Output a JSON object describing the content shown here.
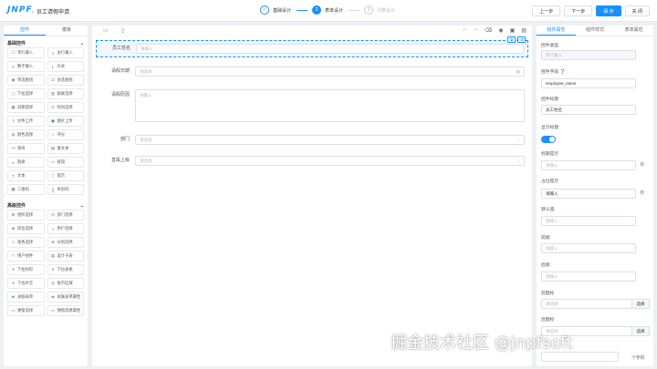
{
  "app": {
    "logo": "JNPF",
    "back": "‹",
    "title": "员工请假申请"
  },
  "steps": [
    {
      "num": "✓",
      "label": "基础设计"
    },
    {
      "num": "2",
      "label": "表单设计"
    },
    {
      "num": "3",
      "label": "列表设计"
    }
  ],
  "top_buttons": {
    "prev": "上一步",
    "next": "下一步",
    "save": "保 存",
    "close": "关 闭"
  },
  "left_panel": {
    "tabs": [
      "控件",
      "模板"
    ],
    "basic_title": "基础控件",
    "basic_items": [
      {
        "icon": "☐",
        "label": "单行输入"
      },
      {
        "icon": "≡",
        "label": "多行输入"
      },
      {
        "icon": "#",
        "label": "数字输入"
      },
      {
        "icon": "◐",
        "label": "开关"
      },
      {
        "icon": "◉",
        "label": "单选框组"
      },
      {
        "icon": "☑",
        "label": "多选框组"
      },
      {
        "icon": "▢",
        "label": "下拉选择"
      },
      {
        "icon": "▥",
        "label": "级联选择"
      },
      {
        "icon": "▦",
        "label": "日期选择"
      },
      {
        "icon": "◷",
        "label": "时间选择"
      },
      {
        "icon": "⇪",
        "label": "文件上传"
      },
      {
        "icon": "▣",
        "label": "图片上传"
      },
      {
        "icon": "◍",
        "label": "颜色选择"
      },
      {
        "icon": "☆",
        "label": "评分"
      },
      {
        "icon": "⊶",
        "label": "滑块"
      },
      {
        "icon": "▤",
        "label": "富文本"
      },
      {
        "icon": "∞",
        "label": "链接"
      },
      {
        "icon": "▭",
        "label": "按钮"
      },
      {
        "icon": "T",
        "label": "文本"
      },
      {
        "icon": "ⓘ",
        "label": "提示"
      },
      {
        "icon": "▩",
        "label": "二维码"
      },
      {
        "icon": "║",
        "label": "条形码"
      }
    ],
    "advanced_title": "高级控件",
    "advanced_items": [
      {
        "icon": "⊞",
        "label": "组织选择"
      },
      {
        "icon": "⊡",
        "label": "部门选择"
      },
      {
        "icon": "◈",
        "label": "岗位选择"
      },
      {
        "icon": "☺",
        "label": "用户选择"
      },
      {
        "icon": "◇",
        "label": "角色选择"
      },
      {
        "icon": "⊕",
        "label": "分组选择"
      },
      {
        "icon": "⚇",
        "label": "用户组件"
      },
      {
        "icon": "▤",
        "label": "设计子表"
      },
      {
        "icon": "▾",
        "label": "下拉树形"
      },
      {
        "icon": "▾",
        "label": "下拉表格"
      },
      {
        "icon": "▾",
        "label": "下拉补全"
      },
      {
        "icon": "◎",
        "label": "省市区域"
      },
      {
        "icon": "⇄",
        "label": "关联表单"
      },
      {
        "icon": "⇄",
        "label": "关联表单属性"
      },
      {
        "icon": "▭",
        "label": "弹窗选择"
      },
      {
        "icon": "▭",
        "label": "弹窗选择属性"
      }
    ]
  },
  "canvas": {
    "fields": [
      {
        "label": "员工姓名",
        "placeholder": "请输入",
        "trail": ""
      },
      {
        "label": "请假日期",
        "placeholder": "请选择",
        "trail": "▦"
      },
      {
        "label": "请假原因",
        "placeholder": "请输入",
        "trail": ""
      },
      {
        "label": "部门",
        "placeholder": "请选择",
        "trail": "⌄"
      },
      {
        "label": "直属上级",
        "placeholder": "请选择",
        "trail": "⌄"
      }
    ]
  },
  "right_panel": {
    "tabs": [
      "组件属性",
      "组件样式",
      "表单属性"
    ],
    "control_type_label": "控件类型",
    "control_type_value": "单行输入",
    "field_label": "控件字段",
    "field_value": "employee_name",
    "title_label": "控件标题",
    "title_value": "员工姓名",
    "show_title_label": "显示标题",
    "title_hint_label": "标题提示",
    "title_hint_placeholder": "请输入",
    "placeholder_label": "占位提示",
    "placeholder_value": "请输入",
    "default_label": "默认值",
    "default_placeholder": "请输入",
    "prefix_label": "前缀",
    "prefix_placeholder": "请输入",
    "suffix_label": "后缀",
    "suffix_placeholder": "请输入",
    "prefix_icon_label": "前图标",
    "prefix_icon_placeholder": "请选择",
    "prefix_icon_button": "选择",
    "suffix_icon_label": "后图标",
    "suffix_icon_placeholder": "请选择",
    "suffix_icon_button": "选择",
    "max_length_unit": "个字符"
  },
  "watermark": "掘金技术社区 @jnpfsoft",
  "colors": {
    "accent": "#1890ff",
    "background": "#eef0f4"
  }
}
